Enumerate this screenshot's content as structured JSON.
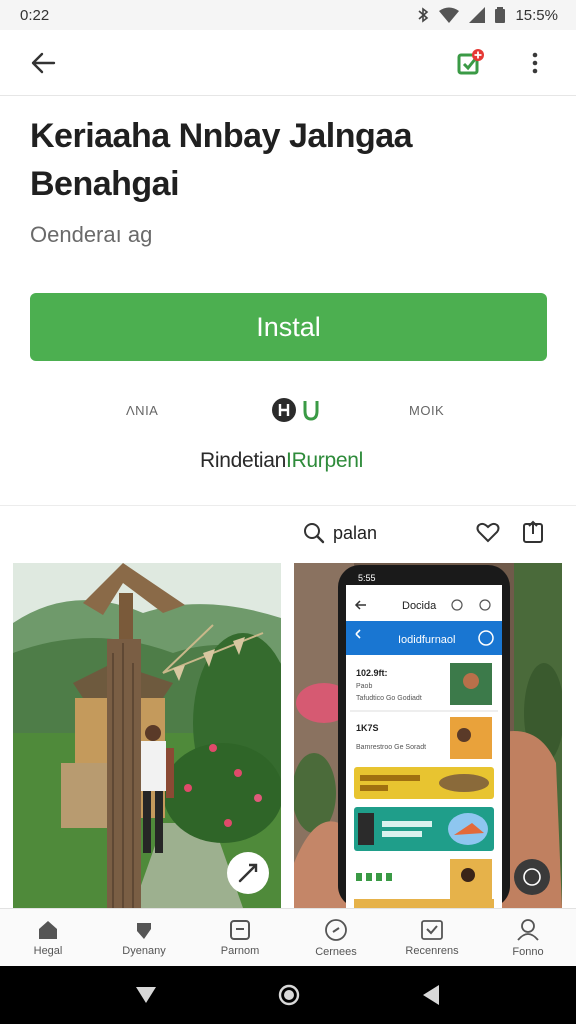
{
  "status_bar": {
    "time": "0:22",
    "battery": "15:5%"
  },
  "app": {
    "title": "Keriaaha Nnbay Jalngaa Benahgai",
    "subtitle": "Oenderaı ag",
    "install_label": "Instal",
    "stats": {
      "left": "ΛΝΙΑ",
      "right": "ΜΟΙΚ"
    },
    "developer": {
      "part1": "Rindetian",
      "part2": "IRurpenl"
    }
  },
  "tools": {
    "search_label": "palan"
  },
  "screenshot_phone": {
    "status_time": "5:55",
    "header": "Docida",
    "bar_title": "Iodidfurnaol",
    "card1_title": "102.9ft:",
    "card1_sub": "Paob",
    "card1_meta": "Tafudtico Go Godiadt",
    "card2_title": "1K7S",
    "card2_meta": "Bamrestroo Ge Soradt"
  },
  "bottom_nav": [
    {
      "label": "Hegal",
      "icon": "home-icon"
    },
    {
      "label": "Dyenany",
      "icon": "tag-icon"
    },
    {
      "label": "Parnom",
      "icon": "tablet-icon"
    },
    {
      "label": "Cernees",
      "icon": "compass-icon"
    },
    {
      "label": "Recenrens",
      "icon": "reviews-icon"
    },
    {
      "label": "Fonno",
      "icon": "profile-icon"
    }
  ],
  "colors": {
    "install_green": "#4caf50",
    "accent_green": "#2e8b3a",
    "app_blue": "#1976d2"
  }
}
